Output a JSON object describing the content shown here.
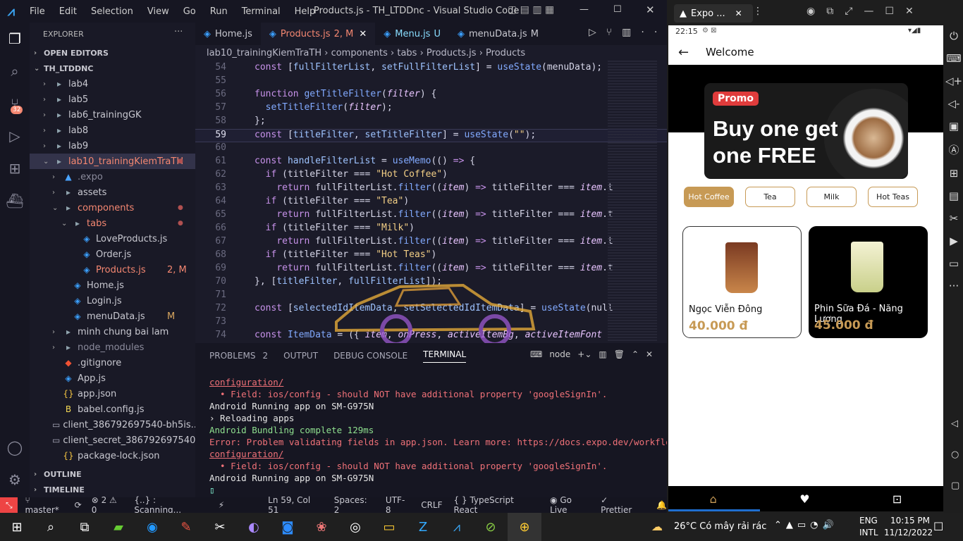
{
  "vscode": {
    "title": "Products.js - TH_LTDDnc - Visual Studio Code",
    "menus": [
      "File",
      "Edit",
      "Selection",
      "View",
      "Go",
      "Run",
      "Terminal",
      "Help"
    ],
    "scm_badge": "32",
    "explorer_title": "EXPLORER",
    "open_editors": "OPEN EDITORS",
    "project": "TH_LTDDNC",
    "tree": [
      {
        "label": "lab4",
        "indent": 1,
        "chev": "›",
        "type": "folder"
      },
      {
        "label": "lab5",
        "indent": 1,
        "chev": "›",
        "type": "folder"
      },
      {
        "label": "lab6_trainingGK",
        "indent": 1,
        "chev": "›",
        "type": "folder"
      },
      {
        "label": "lab8",
        "indent": 1,
        "chev": "›",
        "type": "folder"
      },
      {
        "label": "lab9",
        "indent": 1,
        "chev": "›",
        "type": "folder"
      },
      {
        "label": "lab10_trainingKiemTraTH",
        "indent": 1,
        "chev": "⌄",
        "type": "folder",
        "color": "#f48771",
        "dot": true,
        "selected": true
      },
      {
        "label": ".expo",
        "indent": 2,
        "chev": "›",
        "type": "expo",
        "color": "#8b8b9c"
      },
      {
        "label": "assets",
        "indent": 2,
        "chev": "›",
        "type": "folder"
      },
      {
        "label": "components",
        "indent": 2,
        "chev": "⌄",
        "type": "folder",
        "color": "#f48771",
        "dot": true
      },
      {
        "label": "tabs",
        "indent": 3,
        "chev": "⌄",
        "type": "folder",
        "color": "#f48771",
        "dot": true
      },
      {
        "label": "LoveProducts.js",
        "indent": 4,
        "type": "js"
      },
      {
        "label": "Order.js",
        "indent": 4,
        "type": "js"
      },
      {
        "label": "Products.js",
        "indent": 4,
        "type": "js",
        "color": "#f48771",
        "badge": "2, M"
      },
      {
        "label": "Home.js",
        "indent": 3,
        "type": "js"
      },
      {
        "label": "Login.js",
        "indent": 3,
        "type": "js"
      },
      {
        "label": "menuData.js",
        "indent": 3,
        "type": "js",
        "badge": "M"
      },
      {
        "label": "minh chung bai lam",
        "indent": 2,
        "chev": "›",
        "type": "folder"
      },
      {
        "label": "node_modules",
        "indent": 2,
        "chev": "›",
        "type": "folder",
        "color": "#8b8b9c"
      },
      {
        "label": ".gitignore",
        "indent": 2,
        "type": "git"
      },
      {
        "label": "App.js",
        "indent": 2,
        "type": "js"
      },
      {
        "label": "app.json",
        "indent": 2,
        "type": "json"
      },
      {
        "label": "babel.config.js",
        "indent": 2,
        "type": "babel"
      },
      {
        "label": "client_386792697540-bh5is...",
        "indent": 2,
        "type": "file"
      },
      {
        "label": "client_secret_386792697540...",
        "indent": 2,
        "type": "file"
      },
      {
        "label": "package-lock.json",
        "indent": 2,
        "type": "json"
      }
    ],
    "outline": "OUTLINE",
    "timeline": "TIMELINE",
    "tabs": [
      {
        "label": "Home.js",
        "color": "#c8c8d0"
      },
      {
        "label": "Products.js",
        "suffix": "2, M",
        "color": "#f48771",
        "active": true
      },
      {
        "label": "Menu.js",
        "suffix": "U",
        "color": "#89ddff"
      },
      {
        "label": "menuData.js",
        "suffix": "M",
        "color": "#c8c8d0"
      }
    ],
    "breadcrumb": [
      "lab10_trainingKiemTraTH",
      "components",
      "tabs",
      "Products.js",
      "Products"
    ],
    "code": [
      {
        "n": "54",
        "html": "<span class='kw'>const</span> [<span class='vr'>fullFilterList</span>, <span class='vr'>setFullFilterList</span>] = <span class='fn'>useState</span>(menuData);"
      },
      {
        "n": "55",
        "html": ""
      },
      {
        "n": "56",
        "html": "<span class='kw'>function</span> <span class='fn'>getTitleFilter</span>(<span class='it'>filter</span>) {"
      },
      {
        "n": "57",
        "html": "  <span class='fn'>setTitleFilter</span>(<span class='it'>filter</span>);"
      },
      {
        "n": "58",
        "html": "};"
      },
      {
        "n": "59",
        "html": "<span class='kw'>const</span> [<span class='vr'>titleFilter</span>, <span class='vr'>setTitleFilter</span>] = <span class='fn'>useState</span>(<span class='str'>\"\"</span>);"
      },
      {
        "n": "60",
        "html": ""
      },
      {
        "n": "61",
        "html": "<span class='kw'>const</span> <span class='vr'>handleFilterList</span> = <span class='fn'>useMemo</span>(() <span class='kw'>=&gt;</span> {"
      },
      {
        "n": "62",
        "html": "  <span class='kw'>if</span> (titleFilter === <span class='str'>\"Hot Coffee\"</span>)"
      },
      {
        "n": "63",
        "html": "    <span class='kw'>return</span> fullFilterList.<span class='fn'>filter</span>((<span class='it'>item</span>) <span class='kw'>=&gt;</span> titleFilter === <span class='it'>item</span>.t"
      },
      {
        "n": "64",
        "html": "  <span class='kw'>if</span> (titleFilter === <span class='str'>\"Tea\"</span>)"
      },
      {
        "n": "65",
        "html": "    <span class='kw'>return</span> fullFilterList.<span class='fn'>filter</span>((<span class='it'>item</span>) <span class='kw'>=&gt;</span> titleFilter === <span class='it'>item</span>.t"
      },
      {
        "n": "66",
        "html": "  <span class='kw'>if</span> (titleFilter === <span class='str'>\"Milk\"</span>)"
      },
      {
        "n": "67",
        "html": "    <span class='kw'>return</span> fullFilterList.<span class='fn'>filter</span>((<span class='it'>item</span>) <span class='kw'>=&gt;</span> titleFilter === <span class='it'>item</span>.t"
      },
      {
        "n": "68",
        "html": "  <span class='kw'>if</span> (titleFilter === <span class='str'>\"Hot Teas\"</span>)"
      },
      {
        "n": "69",
        "html": "    <span class='kw'>return</span> fullFilterList.<span class='fn'>filter</span>((<span class='it'>item</span>) <span class='kw'>=&gt;</span> titleFilter === <span class='it'>item</span>.t"
      },
      {
        "n": "70",
        "html": "}, [<span class='vr'>titleFilter</span>, <span class='vr'>fullFilterList</span>]);"
      },
      {
        "n": "71",
        "html": ""
      },
      {
        "n": "72",
        "html": "<span class='kw'>const</span> [<span class='vr'>selectedIdItemData</span>, <span class='vr'>setSelectedIdItemData</span>] = <span class='fn'>useState</span>(null"
      },
      {
        "n": "73",
        "html": ""
      },
      {
        "n": "74",
        "html": "<span class='kw'>const</span> <span class='fn'>ItemData</span> = ({ <span class='it'>item</span>, <span class='it'>onPress</span>, <span class='it'>activeItemBg</span>, <span class='it'>activeItemFont</span>"
      }
    ],
    "panel_tabs": [
      "PROBLEMS",
      "OUTPUT",
      "DEBUG CONSOLE",
      "TERMINAL"
    ],
    "problems_count": "2",
    "terminal_shell": "node",
    "terminal": [
      {
        "t": "configuration/",
        "c": "#f07178",
        "u": true
      },
      {
        "t": "  • Field: ios/config - should NOT have additional property 'googleSignIn'.",
        "c": "#f07178"
      },
      {
        "t": "Android Running app on SM-G975N",
        "c": "#e6e6e6"
      },
      {
        "t": "› Reloading apps",
        "c": "#e6e6e6"
      },
      {
        "t": "Android Bundling complete 129ms",
        "c": "#8fe08f"
      },
      {
        "t": "Error: Problem validating fields in app.json. Learn more: https://docs.expo.dev/workflow/",
        "c": "#f07178"
      },
      {
        "t": "configuration/",
        "c": "#f07178",
        "u": true
      },
      {
        "t": "  • Field: ios/config - should NOT have additional property 'googleSignIn'.",
        "c": "#f07178"
      },
      {
        "t": "Android Running app on SM-G975N",
        "c": "#e6e6e6"
      }
    ],
    "status": {
      "branch": "master*",
      "errors": "⊗ 2 ⚠ 0",
      "scanning": "{..} : Scanning...",
      "position": "Ln 59, Col 51",
      "spaces": "Spaces: 2",
      "encoding": "UTF-8",
      "eol": "CRLF",
      "lang": "TypeScript React",
      "golive": "Go Live",
      "prettier": "✓ Prettier"
    }
  },
  "emulator": {
    "tab_title": "Expo ...",
    "time": "22:15",
    "header_title": "Welcome",
    "promo_badge": "Promo",
    "promo_text": "Buy one get one FREE",
    "categories": [
      "Hot Coffee",
      "Tea",
      "Milk",
      "Hot Teas"
    ],
    "products": [
      {
        "name": "Ngọc Viễn Đông",
        "price": "40.000 đ"
      },
      {
        "name": "Phin Sữa Đá - Năng Lượng",
        "price": "45.000 đ"
      }
    ],
    "accent": "#c79a55"
  },
  "taskbar": {
    "weather": "26°C  Có mây rải rác",
    "lang1": "ENG",
    "lang2": "INTL",
    "time": "10:15 PM",
    "date": "11/12/2022"
  }
}
